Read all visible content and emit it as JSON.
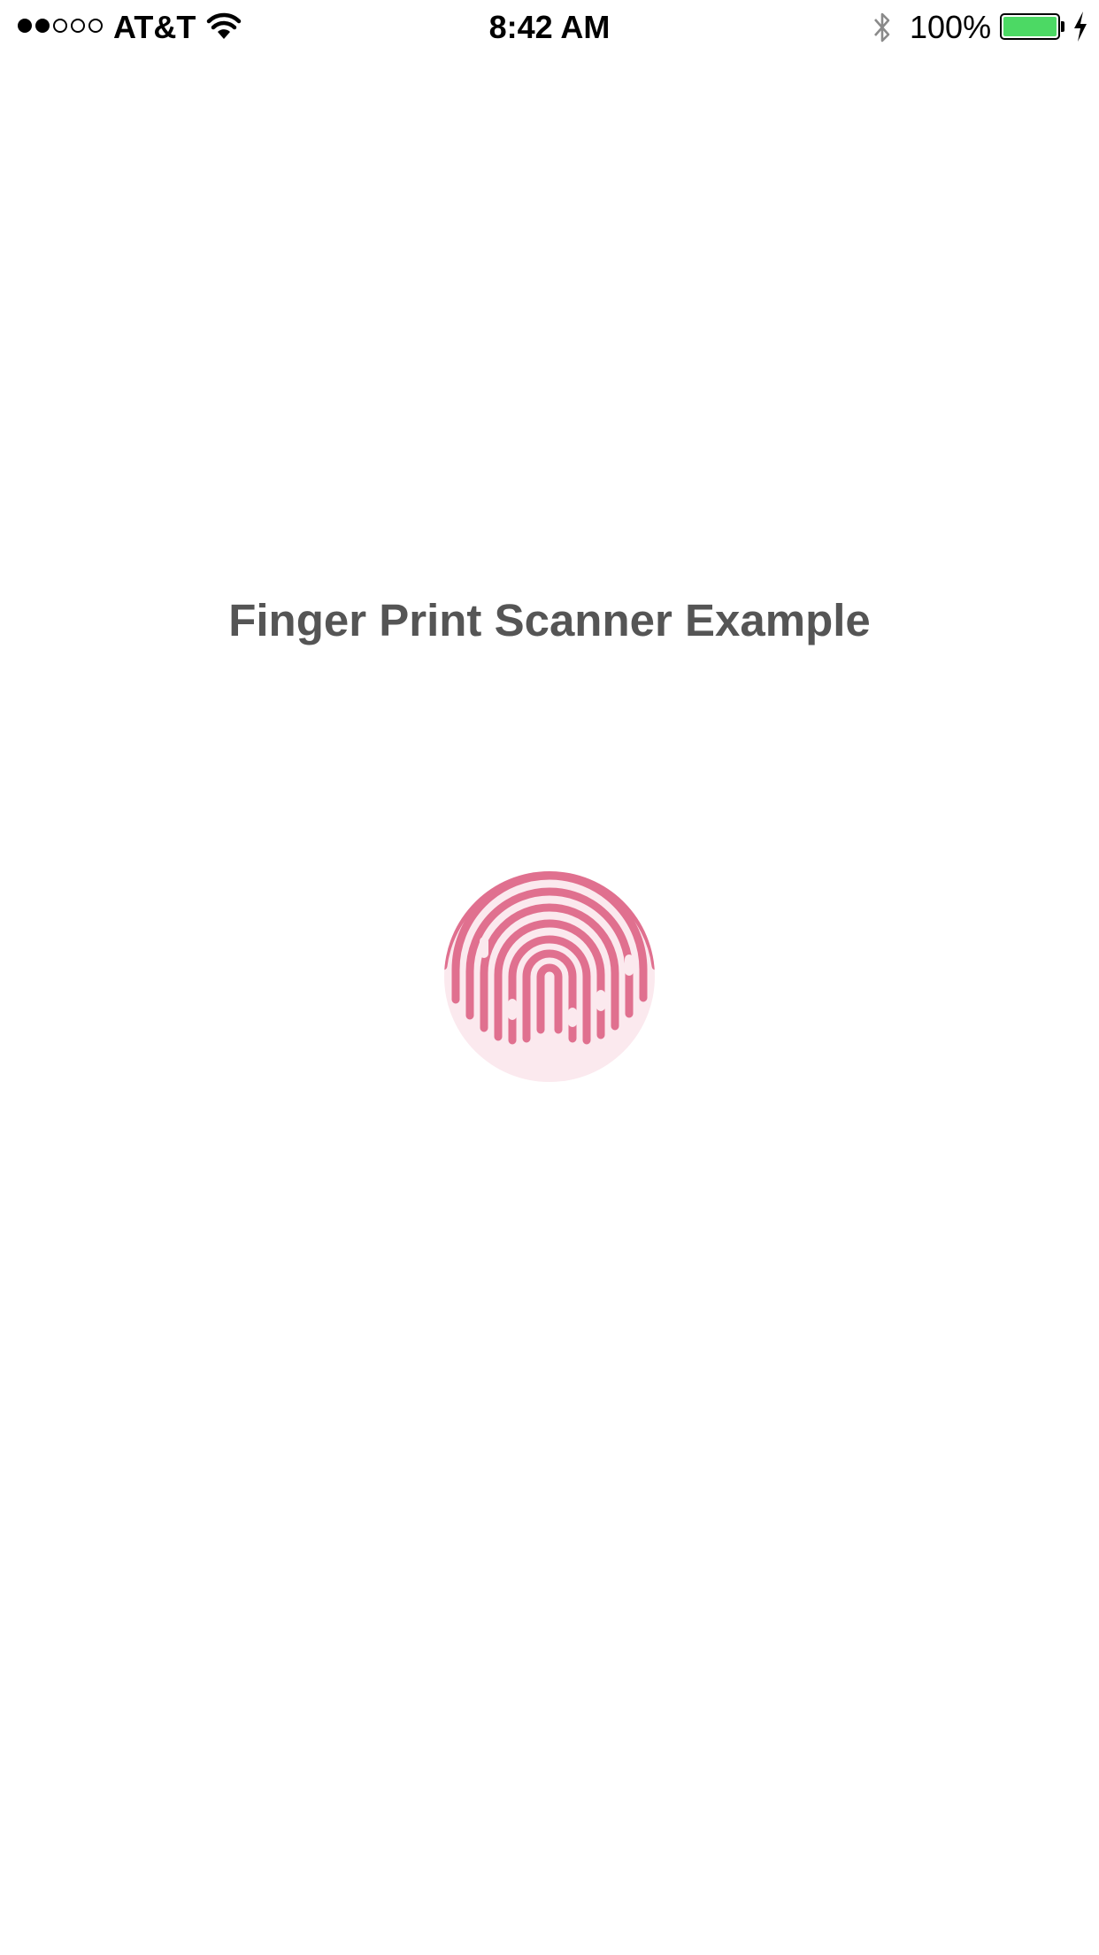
{
  "status_bar": {
    "signal_bars_total": 5,
    "signal_bars_filled": 2,
    "carrier": "AT&T",
    "time": "8:42 AM",
    "battery_percent": "100%",
    "battery_level": 1.0,
    "battery_color": "#4cd964",
    "icons": [
      "signal-icon",
      "wifi-icon",
      "bluetooth-icon",
      "battery-icon",
      "charging-icon"
    ]
  },
  "main": {
    "title": "Finger Print Scanner Example",
    "title_color": "#555555",
    "fingerprint_icon": "fingerprint-icon",
    "fingerprint_color": "#e0708f"
  }
}
